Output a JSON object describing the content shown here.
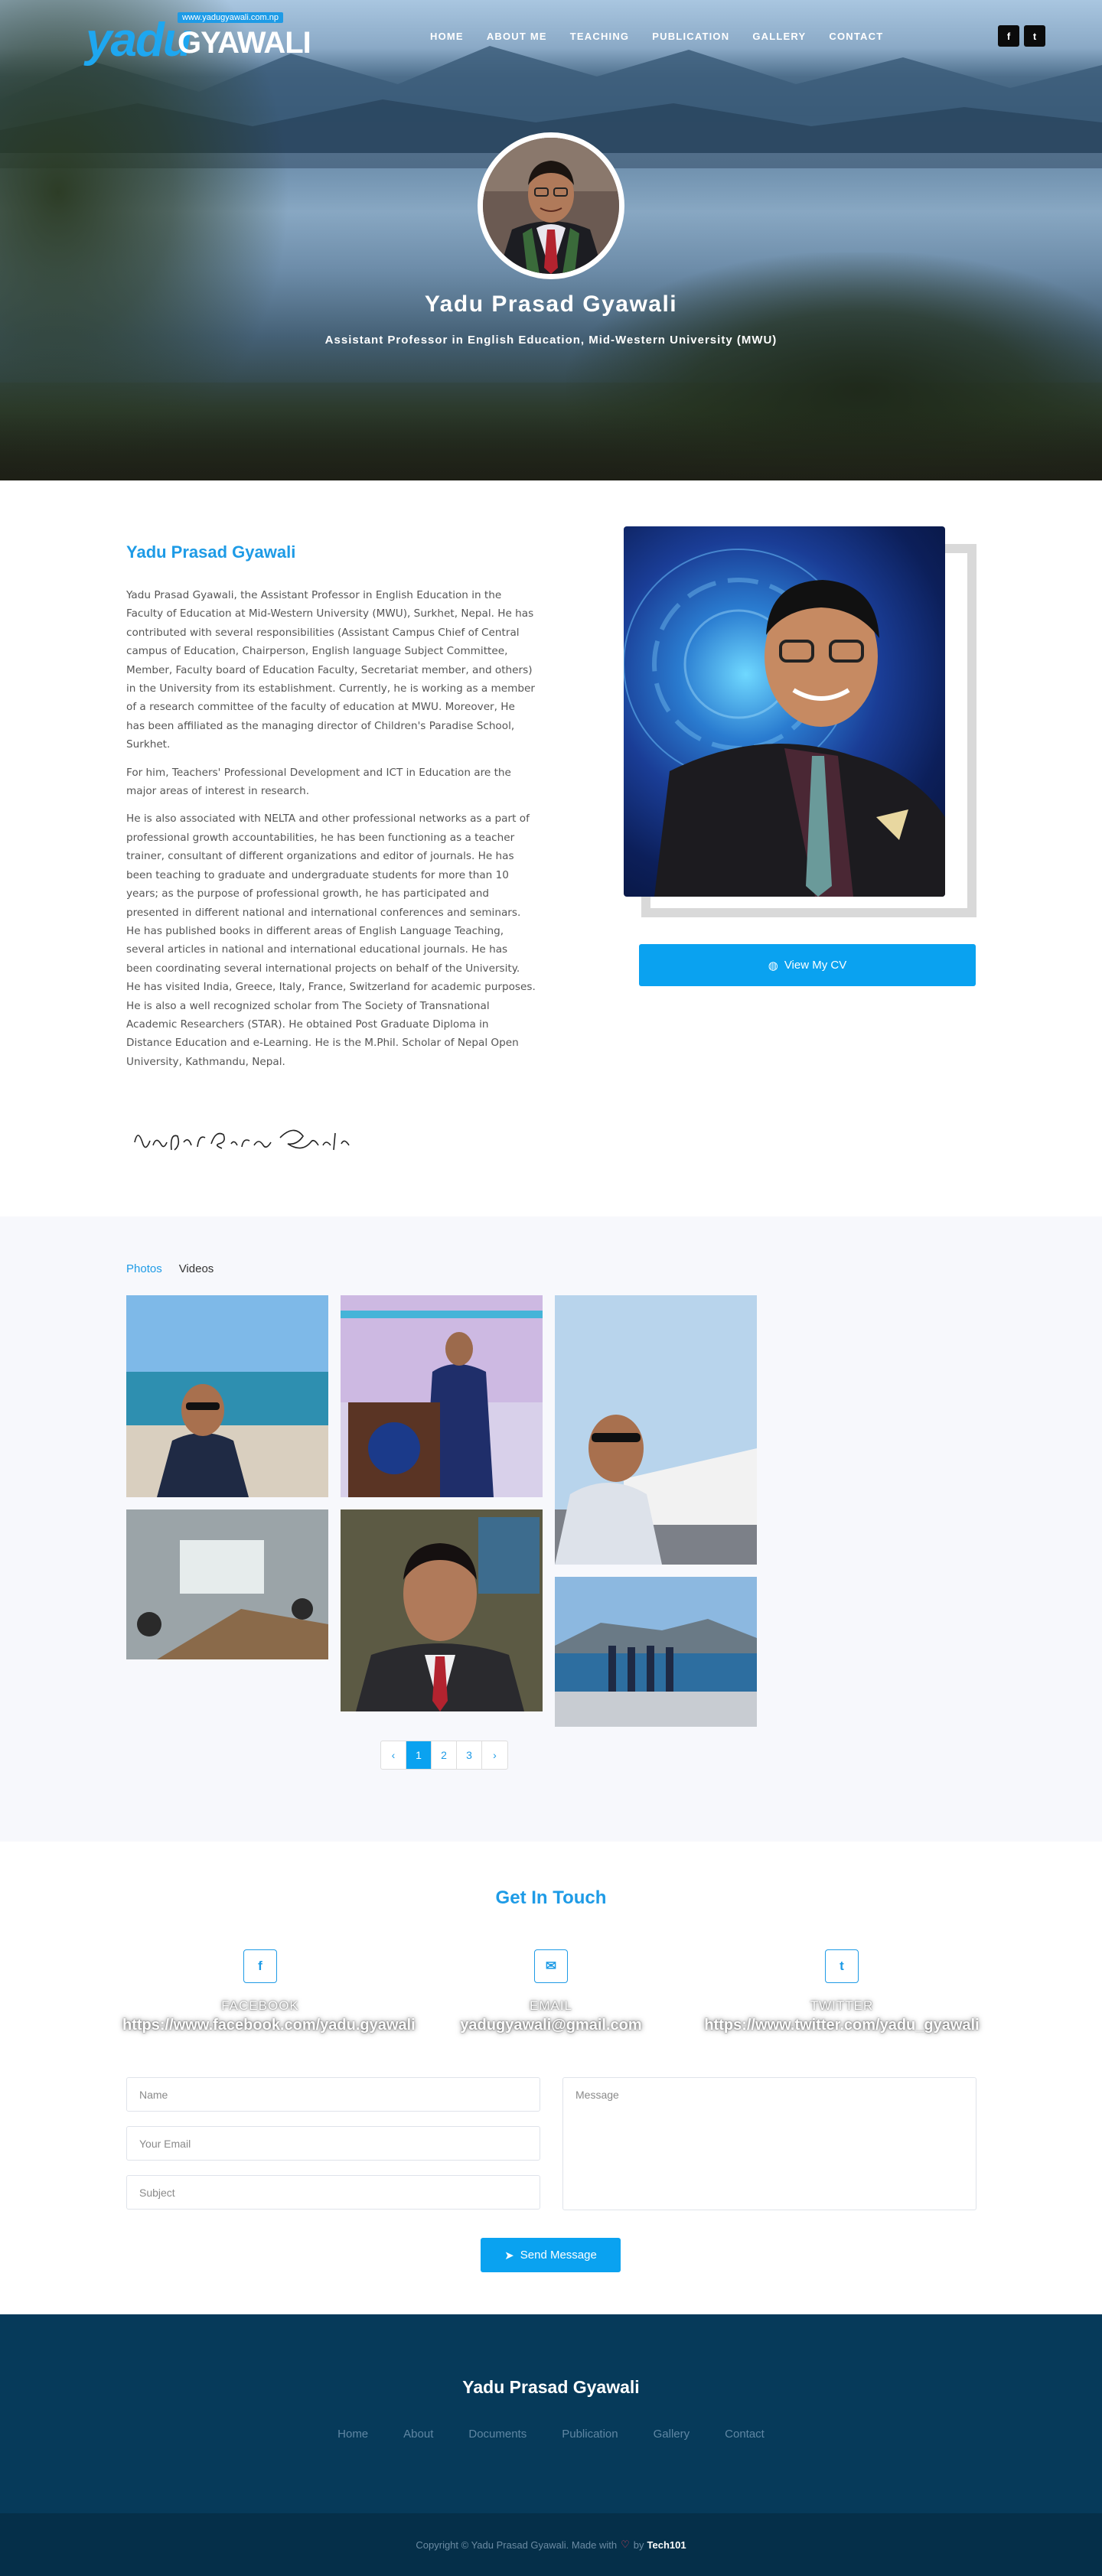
{
  "brand": {
    "url_badge": "www.yadugyawali.com.np",
    "logo_first": "yadu",
    "logo_second": "GYAWALI"
  },
  "nav": {
    "items": [
      "HOME",
      "ABOUT ME",
      "TEACHING",
      "PUBLICATION",
      "GALLERY",
      "CONTACT"
    ],
    "social": [
      "f",
      "t"
    ]
  },
  "hero": {
    "name": "Yadu Prasad Gyawali",
    "subtitle": "Assistant Professor in English Education, Mid-Western University (MWU)"
  },
  "about": {
    "heading": "Yadu Prasad Gyawali",
    "paragraphs": [
      "Yadu Prasad Gyawali, the Assistant Professor in English Education in the Faculty of Education at Mid-Western University (MWU), Surkhet, Nepal. He has contributed with several responsibilities (Assistant Campus Chief of Central campus of Education, Chairperson, English language Subject Committee, Member, Faculty board of Education Faculty, Secretariat member, and others) in the University from its establishment. Currently, he is working as a member of a research committee of the faculty of education at MWU. Moreover, He has been affiliated as the managing director of Children's Paradise School, Surkhet.",
      "For him, Teachers' Professional Development and ICT in Education are the major areas of interest in research.",
      "He is also associated with NELTA and other professional networks as a part of professional growth accountabilities, he has been functioning as a teacher trainer, consultant of different organizations and editor of journals. He has been teaching to graduate and undergraduate students for more than 10 years; as the purpose of professional growth, he has participated and presented in different national and international conferences and seminars. He has published books in different areas of English Language Teaching, several articles in national and international educational journals. He has been coordinating several international projects on behalf of the University. He has visited India, Greece, Italy, France, Switzerland for academic purposes. He is also a well recognized scholar from The Society of Transnational Academic Researchers (STAR). He obtained Post Graduate Diploma in Distance Education and e-Learning. He is the M.Phil. Scholar of Nepal Open University, Kathmandu, Nepal."
    ],
    "signature": "Yadu Prasad Gyawali",
    "cv_button": "View My CV"
  },
  "gallery": {
    "tabs": [
      "Photos",
      "Videos"
    ],
    "active_tab": "Photos",
    "pagination": [
      "‹",
      "1",
      "2",
      "3",
      "›"
    ],
    "current_page": "1"
  },
  "contact": {
    "heading": "Get In Touch",
    "channels": [
      {
        "icon": "f",
        "label": "FACEBOOK",
        "value": "https://www.facebook.com/yadu.gyawali"
      },
      {
        "icon": "✉",
        "label": "EMAIL",
        "value": "yadugyawali@gmail.com"
      },
      {
        "icon": "t",
        "label": "TWITTER",
        "value": "https://www.twitter.com/yadu_gyawali"
      }
    ],
    "form": {
      "name_placeholder": "Name",
      "email_placeholder": "Your Email",
      "subject_placeholder": "Subject",
      "message_placeholder": "Message",
      "send_label": "Send Message"
    }
  },
  "footer": {
    "title": "Yadu Prasad Gyawali",
    "links": [
      "Home",
      "About",
      "Documents",
      "Publication",
      "Gallery",
      "Contact"
    ],
    "copyright_prefix": "Copyright © Yadu Prasad Gyawali. Made with",
    "copyright_by": "by",
    "credit": "Tech101"
  },
  "colors": {
    "accent": "#0aa2f0",
    "footer_bg": "#063a5a",
    "copyright_bg": "#052f49"
  }
}
